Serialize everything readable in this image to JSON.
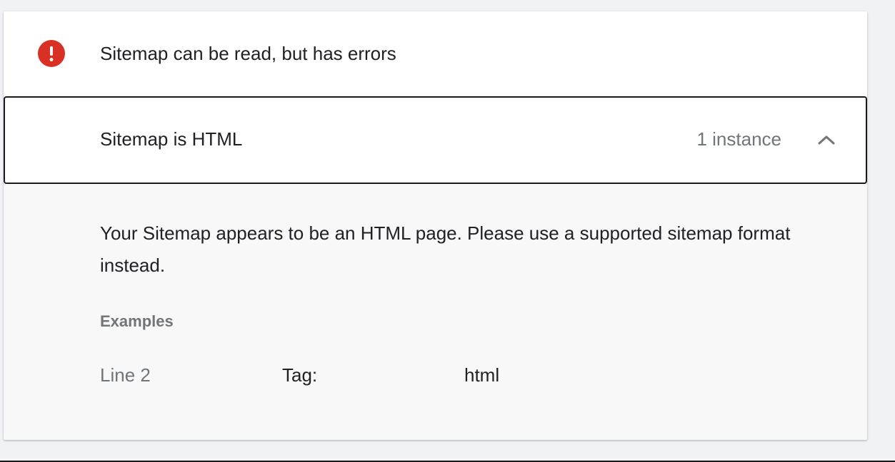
{
  "status": {
    "icon": "error-icon",
    "icon_color": "#d93025",
    "text": "Sitemap can be read, but has errors"
  },
  "issue": {
    "title": "Sitemap is HTML",
    "count_text": "1 instance",
    "expanded": true,
    "chevron_icon": "chevron-up-icon"
  },
  "details": {
    "description": "Your Sitemap appears to be an HTML page. Please use a supported sitemap format instead.",
    "examples_heading": "Examples",
    "examples": [
      {
        "line": "Line 2",
        "key": "Tag:",
        "value": "html"
      }
    ]
  }
}
